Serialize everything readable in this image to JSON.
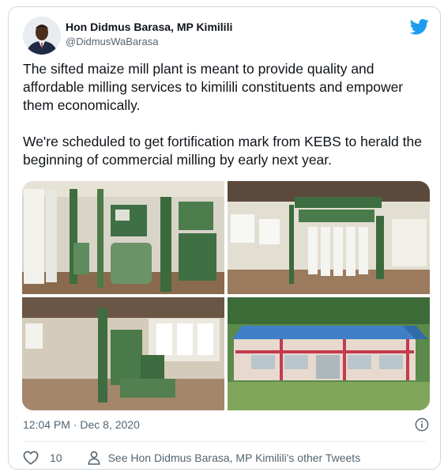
{
  "author": {
    "name": "Hon Didmus Barasa, MP Kimilili",
    "handle": "@DidmusWaBarasa"
  },
  "tweet": {
    "paragraph_1": "The sifted maize mill plant is meant to provide quality and affordable milling services to kimilili constituents and empower them economically.",
    "paragraph_2": "We're scheduled to get fortification mark from KEBS to herald the beginning of commercial milling by early next year."
  },
  "meta": {
    "timestamp": "12:04 PM · Dec 8, 2020"
  },
  "actions": {
    "like_count": "10",
    "other_tweets_label": "See Hon Didmus Barasa, MP Kimilili's other Tweets"
  },
  "icons": {
    "brand": "twitter-bird-icon",
    "info": "info-icon",
    "like": "heart-icon",
    "profile": "person-icon"
  },
  "colors": {
    "brand_blue": "#1d9bf0",
    "text_primary": "#0f1419",
    "text_secondary": "#536471",
    "border": "#cfd9de"
  }
}
